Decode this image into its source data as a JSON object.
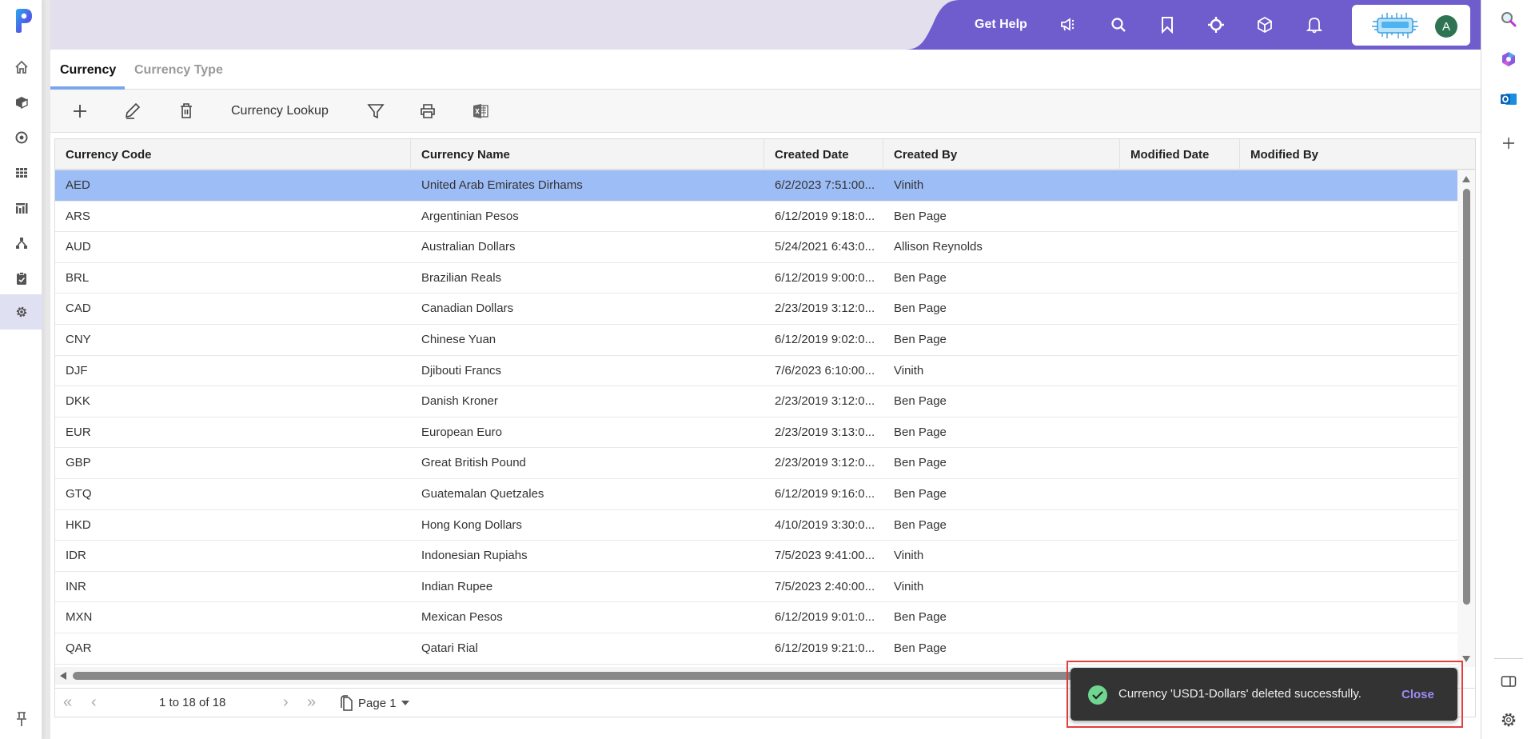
{
  "colors": {
    "header_purple": "#6f5ccd",
    "header_bg": "#e3dfec",
    "selected_row": "#9dbdf7",
    "tab_underline": "#7aa6ec",
    "toast_bg": "#333333",
    "toast_success": "#6fd58f",
    "toast_close": "#9b8cf5",
    "avatar_bg": "#2e7452"
  },
  "leftnav": {
    "logo": "p-logo",
    "items": [
      {
        "icon": "home-icon",
        "label": "Home"
      },
      {
        "icon": "cube-icon",
        "label": "Products"
      },
      {
        "icon": "target-icon",
        "label": "Goals"
      },
      {
        "icon": "grid-icon",
        "label": "Apps"
      },
      {
        "icon": "chart-icon",
        "label": "Reports"
      },
      {
        "icon": "hierarchy-icon",
        "label": "Hierarchy"
      },
      {
        "icon": "clipboard-check-icon",
        "label": "Tasks"
      },
      {
        "icon": "gear-icon",
        "label": "Settings",
        "active": true
      }
    ],
    "pin_icon": "pin-icon"
  },
  "header": {
    "help_label": "Get Help",
    "icons": [
      "megaphone-icon",
      "search-icon",
      "bookmark-icon",
      "crosshair-icon",
      "box-icon",
      "bell-icon"
    ],
    "avatar_initial": "A"
  },
  "rightbar": {
    "icons": [
      "search-icon",
      "copilot-icon",
      "outlook-icon",
      "plus-icon",
      "sidebar-toggle-icon",
      "settings-icon"
    ]
  },
  "tabs": [
    {
      "label": "Currency",
      "active": true
    },
    {
      "label": "Currency Type",
      "active": false
    }
  ],
  "toolbar": {
    "add_icon": "plus-icon",
    "edit_icon": "pencil-icon",
    "delete_icon": "trash-icon",
    "lookup_label": "Currency Lookup",
    "filter_icon": "filter-icon",
    "print_icon": "printer-icon",
    "excel_icon": "excel-icon"
  },
  "grid": {
    "columns": [
      "Currency Code",
      "Currency Name",
      "Created Date",
      "Created By",
      "Modified Date",
      "Modified By"
    ],
    "rows": [
      {
        "code": "AED",
        "name": "United Arab Emirates Dirhams",
        "created_date": "6/2/2023 7:51:00...",
        "created_by": "Vinith",
        "modified_date": "",
        "modified_by": "",
        "selected": true
      },
      {
        "code": "ARS",
        "name": "Argentinian Pesos",
        "created_date": "6/12/2019 9:18:0...",
        "created_by": "Ben Page",
        "modified_date": "",
        "modified_by": ""
      },
      {
        "code": "AUD",
        "name": "Australian Dollars",
        "created_date": "5/24/2021 6:43:0...",
        "created_by": "Allison Reynolds",
        "modified_date": "",
        "modified_by": ""
      },
      {
        "code": "BRL",
        "name": "Brazilian Reals",
        "created_date": "6/12/2019 9:00:0...",
        "created_by": "Ben Page",
        "modified_date": "",
        "modified_by": ""
      },
      {
        "code": "CAD",
        "name": "Canadian Dollars",
        "created_date": "2/23/2019 3:12:0...",
        "created_by": "Ben Page",
        "modified_date": "",
        "modified_by": ""
      },
      {
        "code": "CNY",
        "name": "Chinese Yuan",
        "created_date": "6/12/2019 9:02:0...",
        "created_by": "Ben Page",
        "modified_date": "",
        "modified_by": ""
      },
      {
        "code": "DJF",
        "name": "Djibouti Francs",
        "created_date": "7/6/2023 6:10:00...",
        "created_by": "Vinith",
        "modified_date": "",
        "modified_by": ""
      },
      {
        "code": "DKK",
        "name": "Danish Kroner",
        "created_date": "2/23/2019 3:12:0...",
        "created_by": "Ben Page",
        "modified_date": "",
        "modified_by": ""
      },
      {
        "code": "EUR",
        "name": "European Euro",
        "created_date": "2/23/2019 3:13:0...",
        "created_by": "Ben Page",
        "modified_date": "",
        "modified_by": ""
      },
      {
        "code": "GBP",
        "name": "Great British Pound",
        "created_date": "2/23/2019 3:12:0...",
        "created_by": "Ben Page",
        "modified_date": "",
        "modified_by": ""
      },
      {
        "code": "GTQ",
        "name": "Guatemalan Quetzales",
        "created_date": "6/12/2019 9:16:0...",
        "created_by": "Ben Page",
        "modified_date": "",
        "modified_by": ""
      },
      {
        "code": "HKD",
        "name": "Hong Kong Dollars",
        "created_date": "4/10/2019 3:30:0...",
        "created_by": "Ben Page",
        "modified_date": "",
        "modified_by": ""
      },
      {
        "code": "IDR",
        "name": "Indonesian Rupiahs",
        "created_date": "7/5/2023 9:41:00...",
        "created_by": "Vinith",
        "modified_date": "",
        "modified_by": ""
      },
      {
        "code": "INR",
        "name": "Indian Rupee",
        "created_date": "7/5/2023 2:40:00...",
        "created_by": "Vinith",
        "modified_date": "",
        "modified_by": ""
      },
      {
        "code": "MXN",
        "name": "Mexican Pesos",
        "created_date": "6/12/2019 9:01:0...",
        "created_by": "Ben Page",
        "modified_date": "",
        "modified_by": ""
      },
      {
        "code": "QAR",
        "name": "Qatari Rial",
        "created_date": "6/12/2019 9:21:0...",
        "created_by": "Ben Page",
        "modified_date": "",
        "modified_by": ""
      }
    ]
  },
  "pager": {
    "info": "1 to 18 of 18",
    "page_label": "Page 1"
  },
  "toast": {
    "message": "Currency 'USD1-Dollars' deleted successfully.",
    "close_label": "Close"
  }
}
